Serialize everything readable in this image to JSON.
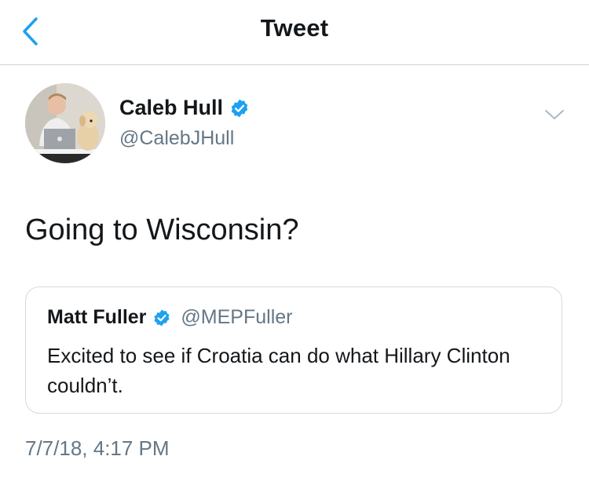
{
  "nav": {
    "title": "Tweet",
    "back_icon": "chevron-left-icon"
  },
  "author": {
    "display_name": "Caleb Hull",
    "handle": "@CalebJHull",
    "verified": true,
    "avatar_icon": "avatar-photo"
  },
  "tweet": {
    "text": "Going to Wisconsin?",
    "timestamp": "7/7/18, 4:17 PM",
    "more_icon": "chevron-down-icon"
  },
  "quoted_tweet": {
    "display_name": "Matt Fuller",
    "handle": "@MEPFuller",
    "verified": true,
    "text": "Excited to see if Croatia can do what Hillary Clinton couldn’t."
  },
  "colors": {
    "accent": "#1da1f2",
    "secondary_text": "#657786",
    "primary_text": "#14171a",
    "border": "#d4d9dd"
  }
}
